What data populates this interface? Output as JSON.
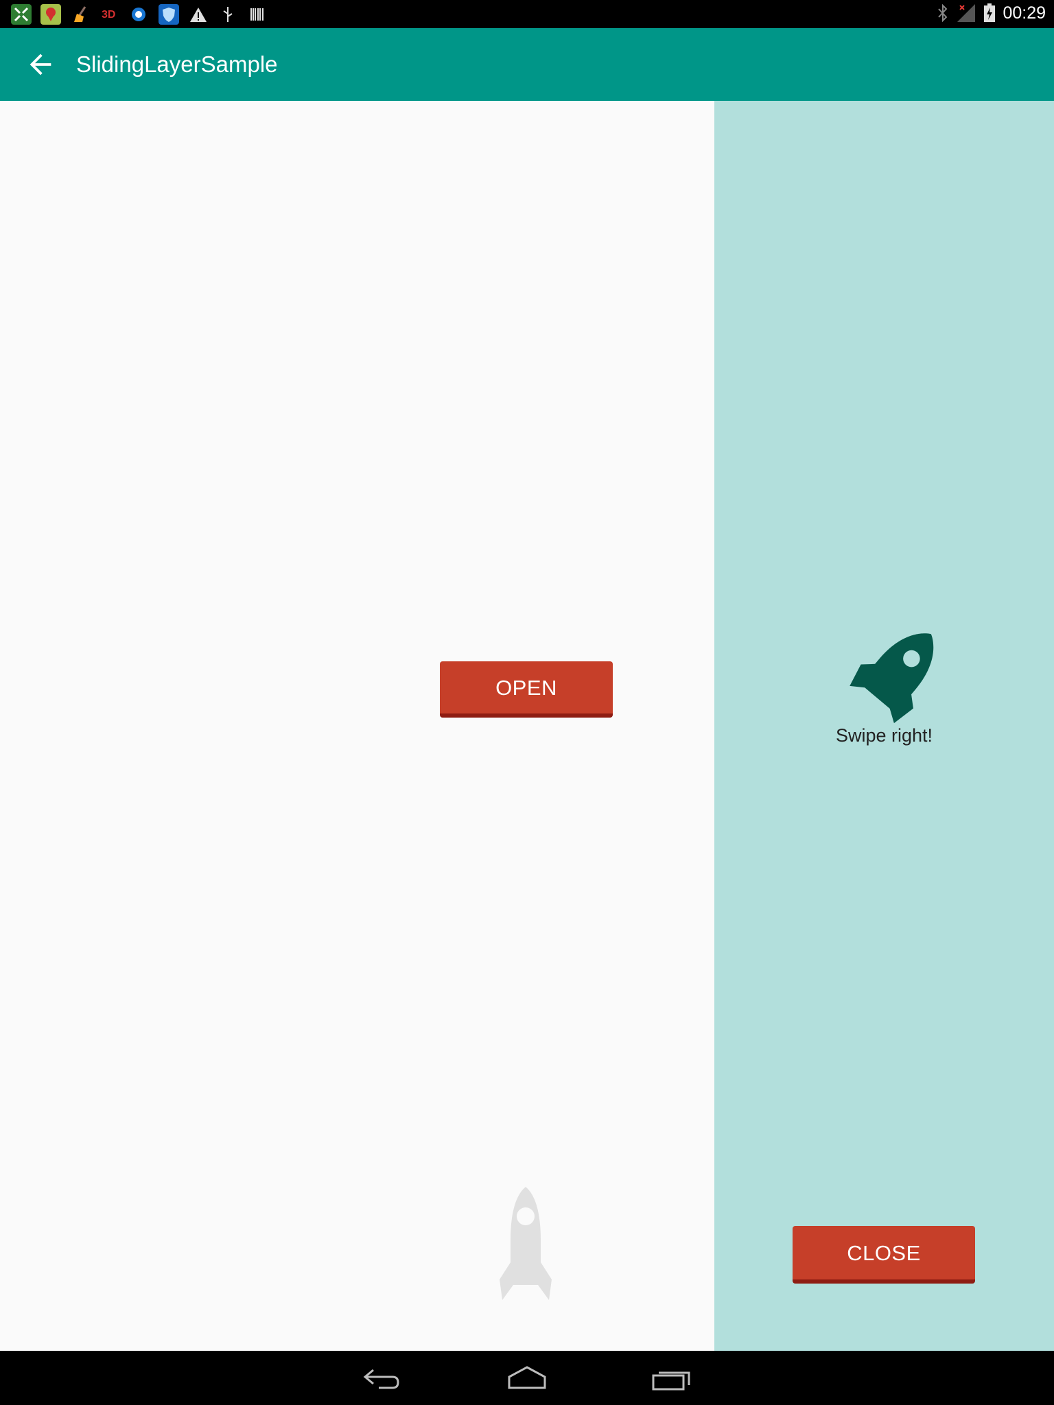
{
  "status_bar": {
    "time": "00:29",
    "left_icons": [
      "app-grid-icon",
      "maps-pin-icon",
      "broom-icon",
      "3d-icon",
      "q-browser-icon",
      "shield-icon",
      "warning-icon",
      "usb-icon",
      "barcode-icon"
    ],
    "right_icons": [
      "bluetooth-icon",
      "no-signal-icon",
      "battery-charging-icon"
    ]
  },
  "app_bar": {
    "title": "SlidingLayerSample",
    "background": "#009688"
  },
  "main": {
    "open_label": "OPEN",
    "button_color": "#c63f29"
  },
  "sliding_layer": {
    "swipe_text": "Swipe right!",
    "close_label": "CLOSE",
    "background": "#b2dfdc",
    "rocket_color": "#05584a"
  },
  "nav_bar": {
    "buttons": [
      "back-nav",
      "home-nav",
      "recents-nav"
    ]
  }
}
